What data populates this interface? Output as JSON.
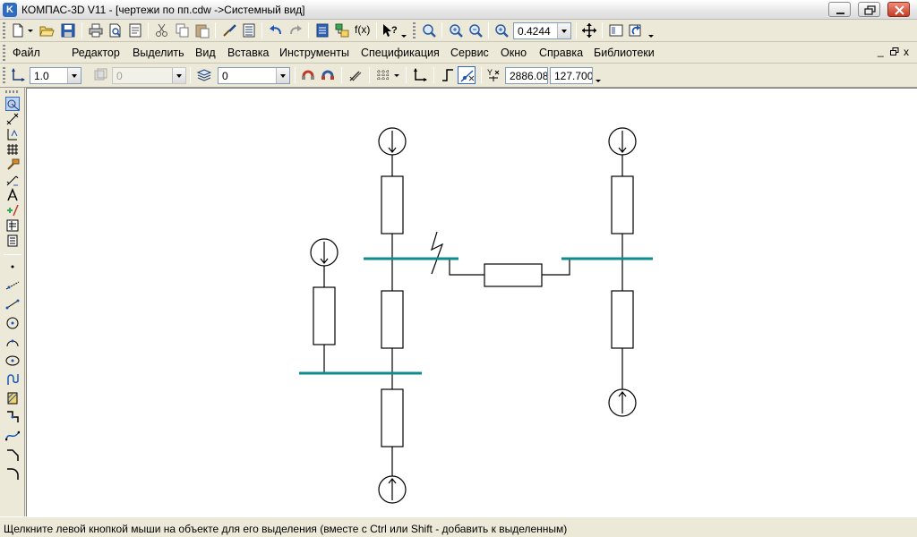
{
  "window": {
    "app_icon_letter": "K",
    "title": "КОМПАС-3D V11 - [чертежи по пп.cdw ->Системный вид]"
  },
  "menu": {
    "items": [
      "Файл",
      "Редактор",
      "Выделить",
      "Вид",
      "Вставка",
      "Инструменты",
      "Спецификация",
      "Сервис",
      "Окно",
      "Справка",
      "Библиотеки"
    ],
    "mdi_minimize": "_",
    "mdi_close": "x"
  },
  "toolbar": {
    "zoom_value": "0.4244",
    "fx_label": "f(x)"
  },
  "props": {
    "style_value": "1.0",
    "layer_value": "0",
    "state_value": "0",
    "y_coord": "2886.08",
    "x_coord": "127.700"
  },
  "status": {
    "text": "Щелкните левой кнопкой мыши на объекте для его выделения (вместе с Ctrl или Shift - добавить к выделенным)"
  },
  "colors": {
    "bus": "#0e8c8c",
    "line": "#000000",
    "canvas": "#ffffff"
  },
  "icons": [
    "new-doc-icon",
    "open-folder-icon",
    "save-icon",
    "print-icon",
    "print-preview-icon",
    "cut-icon",
    "copy-icon",
    "paste-icon",
    "undo-icon",
    "redo-icon",
    "help-icon",
    "zoom-icon",
    "pan-icon",
    "refresh-icon"
  ]
}
